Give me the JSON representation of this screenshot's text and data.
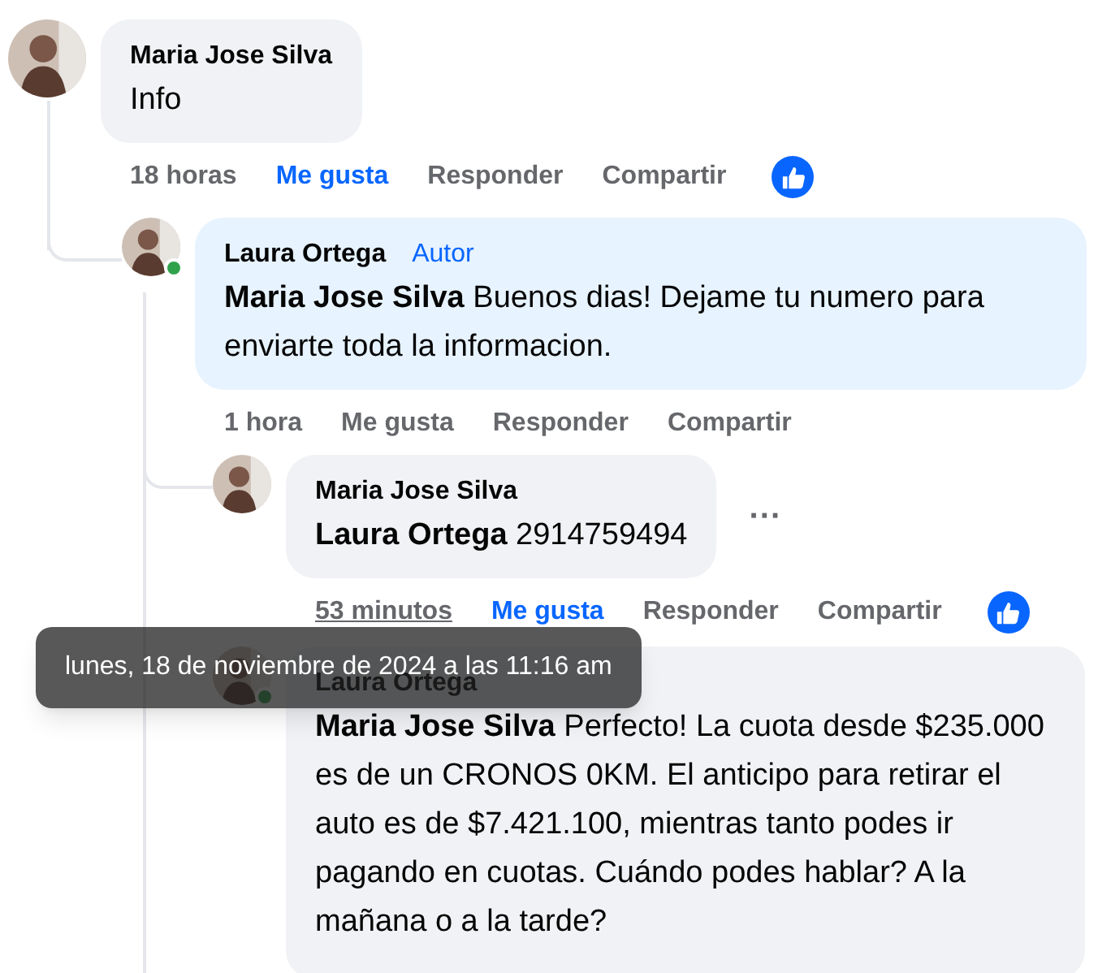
{
  "comments": [
    {
      "author": "Maria Jose Silva",
      "text": "Info",
      "time": "18 horas",
      "like": "Me gusta",
      "liked": true,
      "reply": "Responder",
      "share": "Compartir",
      "reacted": true,
      "online": false,
      "children": [
        {
          "author": "Laura Ortega",
          "badge": "Autor",
          "mention": "Maria Jose Silva",
          "text": "Buenos dias! Dejame tu numero para enviarte toda la informacion.",
          "time": "1 hora",
          "like": "Me gusta",
          "liked": false,
          "reply": "Responder",
          "share": "Compartir",
          "reacted": false,
          "online": true,
          "children": [
            {
              "author": "Maria Jose Silva",
              "mention": "Laura Ortega",
              "text": "2914759494",
              "time": "53 minutos",
              "like": "Me gusta",
              "liked": true,
              "reply": "Responder",
              "share": "Compartir",
              "reacted": true,
              "online": false,
              "more": "···"
            },
            {
              "author": "Laura Ortega",
              "mention": "Maria Jose Silva",
              "text": "Perfecto! La cuota desde $235.000 es de un CRONOS 0KM. El anticipo para retirar el auto es de $7.421.100, mientras tanto podes ir pagando en cuotas. Cuándo podes hablar? A la mañana o a la tarde?",
              "online": true
            }
          ]
        }
      ]
    }
  ],
  "tooltip": "lunes, 18 de noviembre de 2024 a las 11:16 am"
}
